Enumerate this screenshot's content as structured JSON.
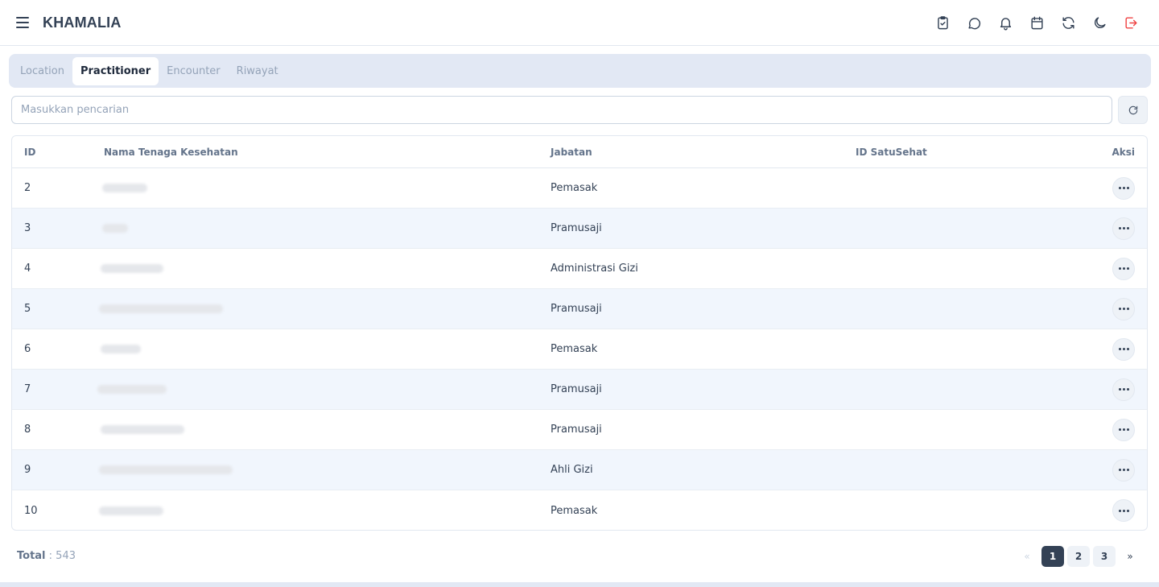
{
  "app": {
    "title": "KHAMALIA"
  },
  "tabs": [
    {
      "label": "Location",
      "active": false
    },
    {
      "label": "Practitioner",
      "active": true
    },
    {
      "label": "Encounter",
      "active": false
    },
    {
      "label": "Riwayat",
      "active": false
    }
  ],
  "search": {
    "placeholder": "Masukkan pencarian",
    "value": ""
  },
  "table": {
    "headers": {
      "id": "ID",
      "name": "Nama Tenaga Kesehatan",
      "job": "Jabatan",
      "satusehat": "ID SatuSehat",
      "action": "Aksi"
    },
    "rows": [
      {
        "id": "2",
        "job": "Pemasak",
        "satusehat": ""
      },
      {
        "id": "3",
        "job": "Pramusaji",
        "satusehat": ""
      },
      {
        "id": "4",
        "job": "Administrasi Gizi",
        "satusehat": ""
      },
      {
        "id": "5",
        "job": "Pramusaji",
        "satusehat": ""
      },
      {
        "id": "6",
        "job": "Pemasak",
        "satusehat": ""
      },
      {
        "id": "7",
        "job": "Pramusaji",
        "satusehat": ""
      },
      {
        "id": "8",
        "job": "Pramusaji",
        "satusehat": ""
      },
      {
        "id": "9",
        "job": "Ahli Gizi",
        "satusehat": ""
      },
      {
        "id": "10",
        "job": "Pemasak",
        "satusehat": ""
      }
    ]
  },
  "footer": {
    "total_label": "Total",
    "total_value": ": 543"
  },
  "pagination": {
    "prev": "«",
    "pages": [
      "1",
      "2",
      "3"
    ],
    "next": "»",
    "current": "1"
  },
  "icons": [
    "menu-icon",
    "clipboard-check-icon",
    "chat-icon",
    "bell-icon",
    "calendar-icon",
    "refresh-icon",
    "moon-icon",
    "logout-icon"
  ],
  "colors": {
    "accent": "#334155",
    "logout": "#ef4444",
    "tab_bg": "#e2e8f4",
    "row_alt": "#f1f6fd"
  }
}
